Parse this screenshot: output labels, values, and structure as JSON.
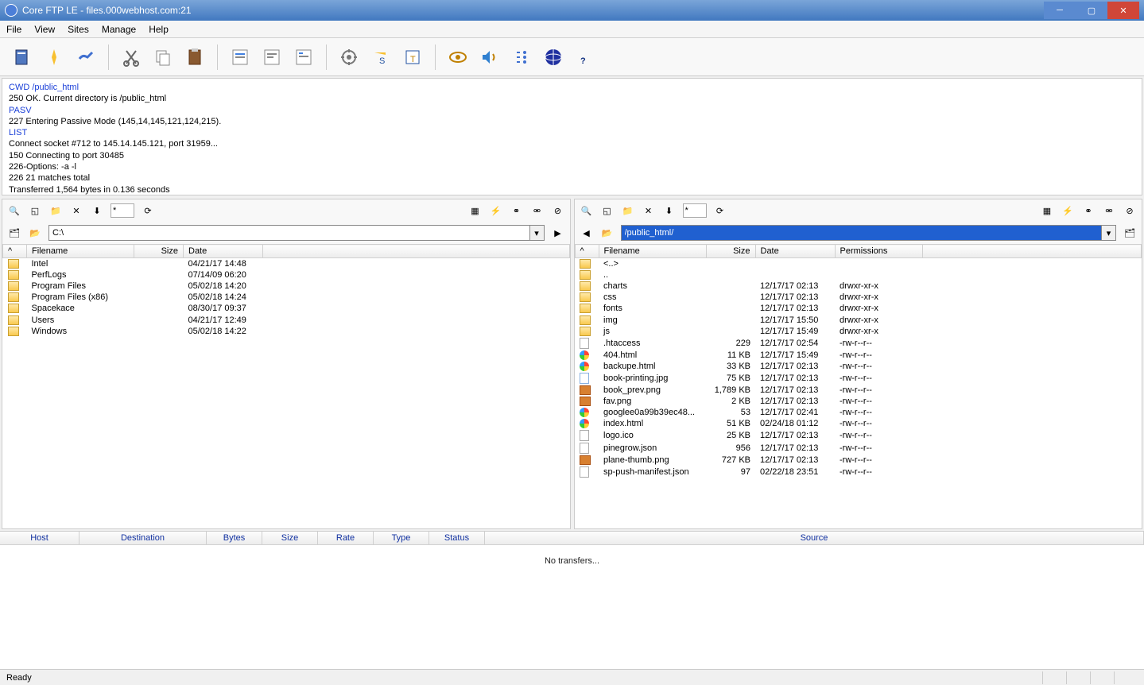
{
  "title": "Core FTP LE - files.000webhost.com:21",
  "menu": [
    "File",
    "View",
    "Sites",
    "Manage",
    "Help"
  ],
  "log": [
    {
      "c": "blue",
      "t": "CWD /public_html"
    },
    {
      "c": "",
      "t": "250 OK. Current directory is /public_html"
    },
    {
      "c": "blue",
      "t": "PASV"
    },
    {
      "c": "",
      "t": "227 Entering Passive Mode (145,14,145,121,124,215)."
    },
    {
      "c": "blue",
      "t": "LIST"
    },
    {
      "c": "",
      "t": "Connect socket #712 to 145.14.145.121, port 31959..."
    },
    {
      "c": "",
      "t": "150 Connecting to port 30485"
    },
    {
      "c": "",
      "t": "226-Options: -a -l"
    },
    {
      "c": "",
      "t": "226 21 matches total"
    },
    {
      "c": "",
      "t": "Transferred 1,564 bytes in 0.136 seconds"
    }
  ],
  "filter": "*",
  "local": {
    "path": "C:\\",
    "columns": [
      "Filename",
      "Size",
      "Date"
    ],
    "files": [
      {
        "ico": "folder",
        "name": "Intel",
        "size": "",
        "date": "04/21/17  14:48"
      },
      {
        "ico": "folder",
        "name": "PerfLogs",
        "size": "",
        "date": "07/14/09  06:20"
      },
      {
        "ico": "folder",
        "name": "Program Files",
        "size": "",
        "date": "05/02/18  14:20"
      },
      {
        "ico": "folder",
        "name": "Program Files (x86)",
        "size": "",
        "date": "05/02/18  14:24"
      },
      {
        "ico": "folder",
        "name": "Spacekace",
        "size": "",
        "date": "08/30/17  09:37"
      },
      {
        "ico": "folder",
        "name": "Users",
        "size": "",
        "date": "04/21/17  12:49"
      },
      {
        "ico": "folder",
        "name": "Windows",
        "size": "",
        "date": "05/02/18  14:22"
      }
    ]
  },
  "remote": {
    "path": "/public_html/",
    "columns": [
      "Filename",
      "Size",
      "Date",
      "Permissions"
    ],
    "files": [
      {
        "ico": "folder",
        "name": "<..>",
        "size": "",
        "date": "",
        "perm": ""
      },
      {
        "ico": "folder",
        "name": "..",
        "size": "",
        "date": "",
        "perm": ""
      },
      {
        "ico": "folder",
        "name": "charts",
        "size": "",
        "date": "12/17/17  02:13",
        "perm": "drwxr-xr-x"
      },
      {
        "ico": "folder",
        "name": "css",
        "size": "",
        "date": "12/17/17  02:13",
        "perm": "drwxr-xr-x"
      },
      {
        "ico": "folder",
        "name": "fonts",
        "size": "",
        "date": "12/17/17  02:13",
        "perm": "drwxr-xr-x"
      },
      {
        "ico": "folder",
        "name": "img",
        "size": "",
        "date": "12/17/17  15:50",
        "perm": "drwxr-xr-x"
      },
      {
        "ico": "folder",
        "name": "js",
        "size": "",
        "date": "12/17/17  15:49",
        "perm": "drwxr-xr-x"
      },
      {
        "ico": "file",
        "name": ".htaccess",
        "size": "229",
        "date": "12/17/17  02:54",
        "perm": "-rw-r--r--"
      },
      {
        "ico": "html",
        "name": "404.html",
        "size": "11 KB",
        "date": "12/17/17  15:49",
        "perm": "-rw-r--r--"
      },
      {
        "ico": "html",
        "name": "backupe.html",
        "size": "33 KB",
        "date": "12/17/17  02:13",
        "perm": "-rw-r--r--"
      },
      {
        "ico": "txt",
        "name": "book-printing.jpg",
        "size": "75 KB",
        "date": "12/17/17  02:13",
        "perm": "-rw-r--r--"
      },
      {
        "ico": "img",
        "name": "book_prev.png",
        "size": "1,789 KB",
        "date": "12/17/17  02:13",
        "perm": "-rw-r--r--"
      },
      {
        "ico": "img",
        "name": "fav.png",
        "size": "2 KB",
        "date": "12/17/17  02:13",
        "perm": "-rw-r--r--"
      },
      {
        "ico": "html",
        "name": "googlee0a99b39ec48...",
        "size": "53",
        "date": "12/17/17  02:41",
        "perm": "-rw-r--r--"
      },
      {
        "ico": "html",
        "name": "index.html",
        "size": "51 KB",
        "date": "02/24/18  01:12",
        "perm": "-rw-r--r--"
      },
      {
        "ico": "file",
        "name": "logo.ico",
        "size": "25 KB",
        "date": "12/17/17  02:13",
        "perm": "-rw-r--r--"
      },
      {
        "ico": "file",
        "name": "pinegrow.json",
        "size": "956",
        "date": "12/17/17  02:13",
        "perm": "-rw-r--r--"
      },
      {
        "ico": "img",
        "name": "plane-thumb.png",
        "size": "727 KB",
        "date": "12/17/17  02:13",
        "perm": "-rw-r--r--"
      },
      {
        "ico": "file",
        "name": "sp-push-manifest.json",
        "size": "97",
        "date": "02/22/18  23:51",
        "perm": "-rw-r--r--"
      }
    ]
  },
  "transferCols": [
    "Host",
    "Destination",
    "Bytes",
    "Size",
    "Rate",
    "Type",
    "Status",
    "Source"
  ],
  "transferColW": [
    100,
    160,
    70,
    70,
    70,
    70,
    70,
    780
  ],
  "noTransfers": "No transfers...",
  "status": "Ready"
}
